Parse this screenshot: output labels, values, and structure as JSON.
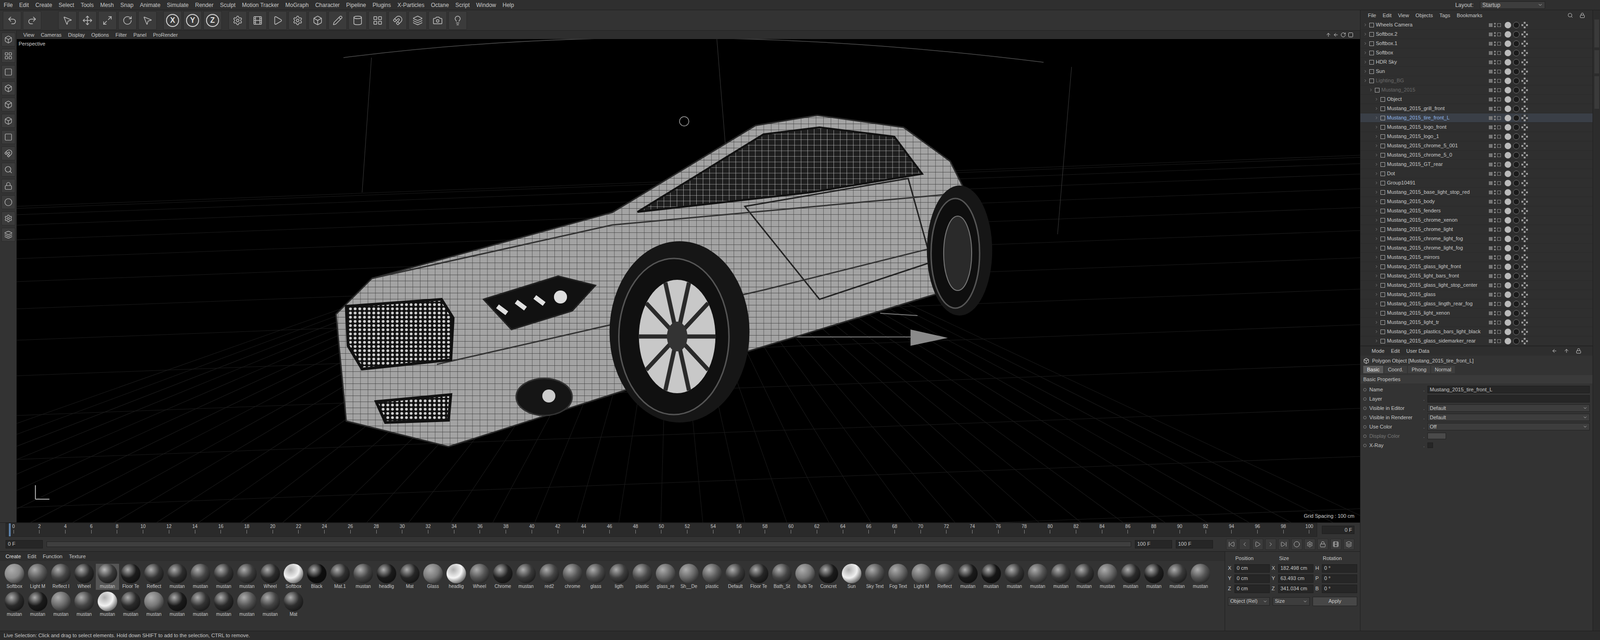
{
  "menubar": {
    "items": [
      "File",
      "Edit",
      "Create",
      "Select",
      "Tools",
      "Mesh",
      "Snap",
      "Animate",
      "Simulate",
      "Render",
      "Sculpt",
      "Motion Tracker",
      "MoGraph",
      "Character",
      "Pipeline",
      "Plugins",
      "X-Particles",
      "Octane",
      "Script",
      "Window",
      "Help"
    ],
    "layout_label": "Layout:",
    "layout_value": "Startup"
  },
  "toolbar": {
    "axis": [
      "X",
      "Y",
      "Z"
    ]
  },
  "viewport": {
    "menu": [
      "View",
      "Cameras",
      "Display",
      "Options",
      "Filter",
      "Panel",
      "ProRender"
    ],
    "view_name": "Perspective",
    "grid_spacing": "Grid Spacing : 100 cm"
  },
  "timeline": {
    "ticks": [
      "0",
      "2",
      "4",
      "6",
      "8",
      "10",
      "12",
      "14",
      "16",
      "18",
      "20",
      "22",
      "24",
      "26",
      "28",
      "30",
      "32",
      "34",
      "36",
      "38",
      "40",
      "42",
      "44",
      "46",
      "48",
      "50",
      "52",
      "54",
      "56",
      "58",
      "60",
      "62",
      "64",
      "66",
      "68",
      "70",
      "72",
      "74",
      "76",
      "78",
      "80",
      "82",
      "84",
      "86",
      "88",
      "90",
      "92",
      "94",
      "96",
      "98",
      "100"
    ],
    "current": "0 F",
    "start": "0 F",
    "end": "100 F",
    "end_max": "100 F"
  },
  "materials": {
    "menu": [
      "Create",
      "Edit",
      "Function",
      "Texture"
    ],
    "items": [
      {
        "name": "Softbox",
        "color": "#8a8a8a",
        "selected": false
      },
      {
        "name": "Light M",
        "color": "#5a5a5a",
        "selected": false
      },
      {
        "name": "Reflect I",
        "color": "#444444",
        "selected": false
      },
      {
        "name": "Wheel",
        "color": "#2a2a2a",
        "selected": false
      },
      {
        "name": "mustan",
        "color": "#3a3a3a",
        "selected": true
      },
      {
        "name": "Floor Te",
        "color": "#1c1c1c",
        "selected": false
      },
      {
        "name": "Reflect",
        "color": "#333333",
        "selected": false
      },
      {
        "name": "mustan",
        "color": "#2d2d2d",
        "selected": false
      },
      {
        "name": "mustan",
        "color": "#444444",
        "selected": false
      },
      {
        "name": "mustan",
        "color": "#333333",
        "selected": false
      },
      {
        "name": "mustan",
        "color": "#3c3c3c",
        "selected": false
      },
      {
        "name": "Wheel",
        "color": "#2a2a2a",
        "selected": false
      },
      {
        "name": "Softbox",
        "color": "#f2f2f2",
        "selected": false
      },
      {
        "name": "Black",
        "color": "#0e0e0e",
        "selected": false
      },
      {
        "name": "Mat.1",
        "color": "#2e2e2e",
        "selected": false
      },
      {
        "name": "mustan",
        "color": "#444444",
        "selected": false
      },
      {
        "name": "headlig",
        "color": "#1a1a1a",
        "selected": false
      },
      {
        "name": "Mat",
        "color": "#262626",
        "selected": false
      },
      {
        "name": "Glass",
        "color": "#7a7a7a",
        "selected": false
      },
      {
        "name": "headlig",
        "color": "#f5f5f5",
        "selected": false
      },
      {
        "name": "Wheel",
        "color": "#555555",
        "selected": false
      },
      {
        "name": "Chrome",
        "color": "#222222",
        "selected": false
      },
      {
        "name": "mustan",
        "color": "#3a3a3a",
        "selected": false
      },
      {
        "name": "red2",
        "color": "#444444",
        "selected": false
      },
      {
        "name": "chrome",
        "color": "#555555",
        "selected": false
      },
      {
        "name": "glass",
        "color": "#4a4a4a",
        "selected": false
      },
      {
        "name": "ligth",
        "color": "#3d3d3d",
        "selected": false
      },
      {
        "name": "plastic",
        "color": "#4a4a4a",
        "selected": false
      },
      {
        "name": "glass_re",
        "color": "#666666",
        "selected": false
      },
      {
        "name": "Sh__De",
        "color": "#6a6a6a",
        "selected": false
      },
      {
        "name": "plastic",
        "color": "#5a5a5a",
        "selected": false
      },
      {
        "name": "Default",
        "color": "#3a3a3a",
        "selected": false
      },
      {
        "name": "Floor Te",
        "color": "#262626",
        "selected": false
      },
      {
        "name": "Bath_St",
        "color": "#444444",
        "selected": false
      },
      {
        "name": "Bulb Te",
        "color": "#777777",
        "selected": false
      },
      {
        "name": "Concret",
        "color": "#1a1a1a",
        "selected": false
      },
      {
        "name": "Sun",
        "color": "#f0f0f0",
        "selected": false
      },
      {
        "name": "Sky Text",
        "color": "#555555",
        "selected": false
      },
      {
        "name": "Fog Text",
        "color": "#666666",
        "selected": false
      },
      {
        "name": "Light M",
        "color": "#6a6a6a",
        "selected": false
      },
      {
        "name": "Reflect",
        "color": "#555555",
        "selected": false
      },
      {
        "name": "mustan",
        "color": "#1a1a1a",
        "selected": false
      },
      {
        "name": "mustan",
        "color": "#151515",
        "selected": false
      },
      {
        "name": "mustan",
        "color": "#333333",
        "selected": false
      },
      {
        "name": "mustan",
        "color": "#555555",
        "selected": false
      },
      {
        "name": "mustan",
        "color": "#3a3a3a",
        "selected": false
      },
      {
        "name": "mustan",
        "color": "#333333",
        "selected": false
      },
      {
        "name": "mustan",
        "color": "#666666",
        "selected": false
      },
      {
        "name": "mustan",
        "color": "#2a2a2a",
        "selected": false
      },
      {
        "name": "mustan",
        "color": "#1e1e1e",
        "selected": false
      },
      {
        "name": "mustan",
        "color": "#3a3a3a",
        "selected": false
      },
      {
        "name": "mustan",
        "color": "#555555",
        "selected": false
      },
      {
        "name": "mustan",
        "color": "#2a2a2a",
        "selected": false
      },
      {
        "name": "mustan",
        "color": "#1a1a1a",
        "selected": false
      },
      {
        "name": "mustan",
        "color": "#6a6a6a",
        "selected": false
      },
      {
        "name": "mustan",
        "color": "#444444",
        "selected": false
      },
      {
        "name": "mustan",
        "color": "#f2f2f2",
        "selected": false
      },
      {
        "name": "mustan",
        "color": "#2a2a2a",
        "selected": false
      },
      {
        "name": "mustan",
        "color": "#777777",
        "selected": false
      },
      {
        "name": "mustan",
        "color": "#1a1a1a",
        "selected": false
      },
      {
        "name": "mustan",
        "color": "#333333",
        "selected": false
      },
      {
        "name": "mustan",
        "color": "#2a2a2a",
        "selected": false
      },
      {
        "name": "mustan",
        "color": "#555555",
        "selected": false
      },
      {
        "name": "mustan",
        "color": "#444444",
        "selected": false
      },
      {
        "name": "Mat",
        "color": "#2e2e2e",
        "selected": false
      }
    ]
  },
  "coordinates": {
    "headers": [
      "Position",
      "Size",
      "Rotation"
    ],
    "rows": [
      {
        "axis": "X",
        "position": "0 cm",
        "size_axis": "X",
        "size": "182.498 cm",
        "rot_axis": "H",
        "rotation": "0 °"
      },
      {
        "axis": "Y",
        "position": "0 cm",
        "size_axis": "Y",
        "size": "63.493 cm",
        "rot_axis": "P",
        "rotation": "0 °"
      },
      {
        "axis": "Z",
        "position": "0 cm",
        "size_axis": "Z",
        "size": "341.034 cm",
        "rot_axis": "B",
        "rotation": "0 °"
      }
    ],
    "mode": "Object (Rel)",
    "size_mode": "Size",
    "apply": "Apply"
  },
  "object_manager": {
    "menu": [
      "File",
      "Edit",
      "View",
      "Objects",
      "Tags",
      "Bookmarks"
    ],
    "objects": [
      {
        "name": "Wheels Camera",
        "depth": 0,
        "selected": false,
        "hidden": false
      },
      {
        "name": "Softbox.2",
        "depth": 0,
        "selected": false,
        "hidden": false
      },
      {
        "name": "Softbox.1",
        "depth": 0,
        "selected": false,
        "hidden": false
      },
      {
        "name": "Softbox",
        "depth": 0,
        "selected": false,
        "hidden": false
      },
      {
        "name": "HDR Sky",
        "depth": 0,
        "selected": false,
        "hidden": false
      },
      {
        "name": "Sun",
        "depth": 0,
        "selected": false,
        "hidden": false
      },
      {
        "name": "Lighting_BG",
        "depth": 0,
        "selected": false,
        "hidden": true
      },
      {
        "name": "Mustang_2015",
        "depth": 1,
        "selected": false,
        "hidden": true
      },
      {
        "name": "Object",
        "depth": 2,
        "selected": false,
        "hidden": false
      },
      {
        "name": "Mustang_2015_grill_front",
        "depth": 2,
        "selected": false,
        "hidden": false
      },
      {
        "name": "Mustang_2015_tire_front_L",
        "depth": 2,
        "selected": true,
        "hidden": false
      },
      {
        "name": "Mustang_2015_logo_front",
        "depth": 2,
        "selected": false,
        "hidden": false
      },
      {
        "name": "Mustang_2015_logo_1",
        "depth": 2,
        "selected": false,
        "hidden": false
      },
      {
        "name": "Mustang_2015_chrome_5_001",
        "depth": 2,
        "selected": false,
        "hidden": false
      },
      {
        "name": "Mustang_2015_chrome_5_0",
        "depth": 2,
        "selected": false,
        "hidden": false
      },
      {
        "name": "Mustang_2015_GT_rear",
        "depth": 2,
        "selected": false,
        "hidden": false
      },
      {
        "name": "Dot",
        "depth": 2,
        "selected": false,
        "hidden": false
      },
      {
        "name": "Group10491",
        "depth": 2,
        "selected": false,
        "hidden": false
      },
      {
        "name": "Mustang_2015_base_light_stop_red",
        "depth": 2,
        "selected": false,
        "hidden": false
      },
      {
        "name": "Mustang_2015_body",
        "depth": 2,
        "selected": false,
        "hidden": false
      },
      {
        "name": "Mustang_2015_fenders",
        "depth": 2,
        "selected": false,
        "hidden": false
      },
      {
        "name": "Mustang_2015_chrome_xenon",
        "depth": 2,
        "selected": false,
        "hidden": false
      },
      {
        "name": "Mustang_2015_chrome_light",
        "depth": 2,
        "selected": false,
        "hidden": false
      },
      {
        "name": "Mustang_2015_chrome_light_fog",
        "depth": 2,
        "selected": false,
        "hidden": false
      },
      {
        "name": "Mustang_2015_chrome_light_fog",
        "depth": 2,
        "selected": false,
        "hidden": false
      },
      {
        "name": "Mustang_2015_mirrors",
        "depth": 2,
        "selected": false,
        "hidden": false
      },
      {
        "name": "Mustang_2015_glass_light_front",
        "depth": 2,
        "selected": false,
        "hidden": false
      },
      {
        "name": "Mustang_2015_light_bars_front",
        "depth": 2,
        "selected": false,
        "hidden": false
      },
      {
        "name": "Mustang_2015_glass_light_stop_center",
        "depth": 2,
        "selected": false,
        "hidden": false
      },
      {
        "name": "Mustang_2015_glass",
        "depth": 2,
        "selected": false,
        "hidden": false
      },
      {
        "name": "Mustang_2015_glass_lingth_rear_fog",
        "depth": 2,
        "selected": false,
        "hidden": false
      },
      {
        "name": "Mustang_2015_light_xenon",
        "depth": 2,
        "selected": false,
        "hidden": false
      },
      {
        "name": "Mustang_2015_light_tr",
        "depth": 2,
        "selected": false,
        "hidden": false
      },
      {
        "name": "Mustang_2015_plastics_bars_light_black",
        "depth": 2,
        "selected": false,
        "hidden": false
      },
      {
        "name": "Mustang_2015_glass_sidemarker_rear",
        "depth": 2,
        "selected": false,
        "hidden": false
      }
    ]
  },
  "attributes": {
    "menu": [
      "Mode",
      "Edit",
      "User Data"
    ],
    "title": "Polygon Object [Mustang_2015_tire_front_L]",
    "tabs": [
      {
        "label": "Basic",
        "selected": true
      },
      {
        "label": "Coord.",
        "selected": false
      },
      {
        "label": "Phong",
        "selected": false
      },
      {
        "label": "Normal",
        "selected": false
      }
    ],
    "section": "Basic Properties",
    "fields": [
      {
        "label": "Name",
        "kind": "text",
        "value": "Mustang_2015_tire_front_L",
        "disabled": false
      },
      {
        "label": "Layer",
        "kind": "text",
        "value": "",
        "disabled": false
      },
      {
        "label": "Visible in Editor",
        "kind": "dropdown",
        "value": "Default",
        "disabled": false
      },
      {
        "label": "Visible in Renderer",
        "kind": "dropdown",
        "value": "Default",
        "disabled": false
      },
      {
        "label": "Use Color",
        "kind": "dropdown",
        "value": "Off",
        "disabled": false
      },
      {
        "label": "Display Color",
        "kind": "color",
        "value": "",
        "disabled": true
      },
      {
        "label": "X-Ray",
        "kind": "checkbox",
        "value": "",
        "disabled": false,
        "checked": false
      }
    ]
  },
  "status_bar": "Live Selection: Click and drag to select elements. Hold down SHIFT to add to the selection, CTRL to remove."
}
